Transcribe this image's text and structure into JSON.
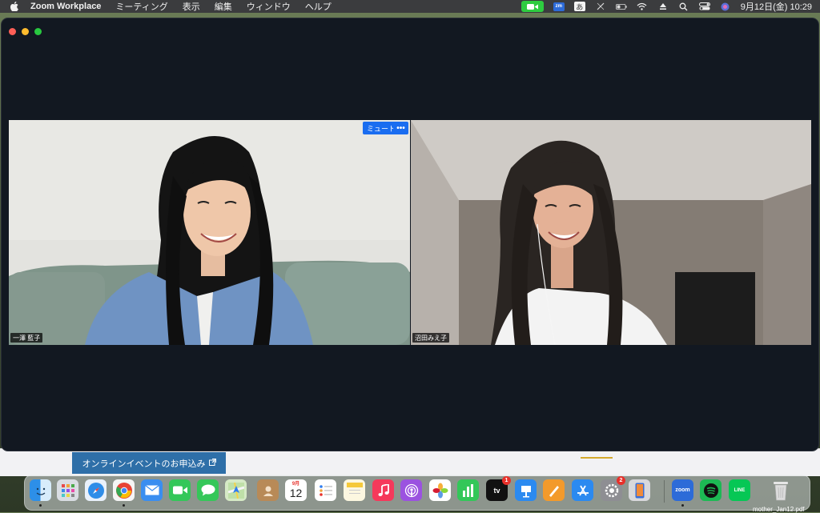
{
  "menubar": {
    "app_name": "Zoom Workplace",
    "menus": [
      "ミーティング",
      "表示",
      "編集",
      "ウィンドウ",
      "ヘルプ"
    ],
    "ime_label": "あ",
    "zoom_label": "zm",
    "datetime": "9月12日(金)  10:29"
  },
  "meeting": {
    "mute_button": "ミュート",
    "more_button": "•••",
    "participants": [
      {
        "name": "一澤 藍子"
      },
      {
        "name": "沼田みえ子"
      }
    ]
  },
  "browser": {
    "banner_text": "オンラインイベントのお申込み"
  },
  "dock": {
    "calendar_month": "9月",
    "calendar_day": "12",
    "tv_badge": "1",
    "settings_badge": "2",
    "zoom_label": "zoom",
    "line_label": "LINE",
    "desktop_file": "mother_Jan12.pdf"
  },
  "colors": {
    "zoom_blue": "#1a6df0",
    "window_bg": "#121821",
    "menubar_bg": "#3b3c3e"
  }
}
